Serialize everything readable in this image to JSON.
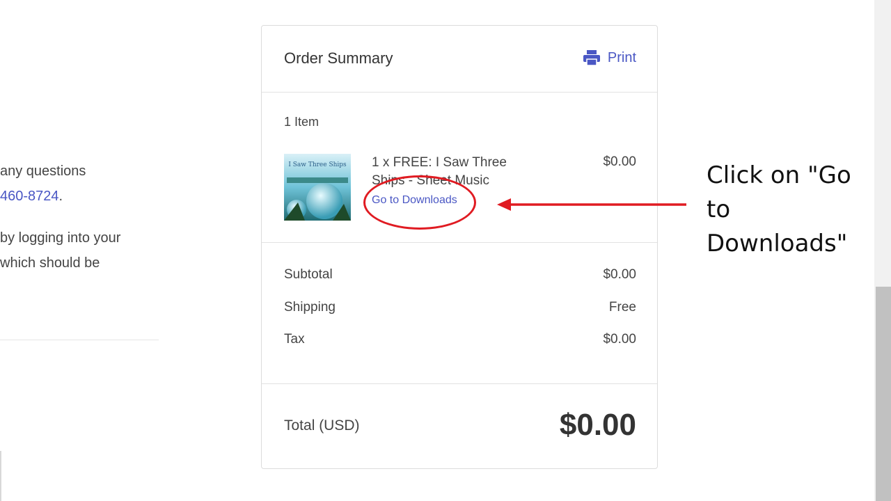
{
  "left_text": {
    "line1": "any questions",
    "phone": "460-8724",
    "phone_suffix": ".",
    "line3": "by logging into your",
    "line4": "which should be"
  },
  "order_summary": {
    "title": "Order Summary",
    "print_label": "Print",
    "item_count": "1 Item",
    "item": {
      "description": "1 x FREE: I Saw Three Ships - Sheet Music",
      "link": "Go to Downloads",
      "price": "$0.00",
      "thumb_text": "I Saw Three Ships"
    },
    "subtotal_label": "Subtotal",
    "subtotal_value": "$0.00",
    "shipping_label": "Shipping",
    "shipping_value": "Free",
    "tax_label": "Tax",
    "tax_value": "$0.00",
    "total_label": "Total (USD)",
    "total_value": "$0.00"
  },
  "annotation": {
    "text": "Click on \"Go to Downloads\"",
    "color": "#e01b22"
  },
  "colors": {
    "link": "#4a57c4",
    "text": "#444444"
  }
}
